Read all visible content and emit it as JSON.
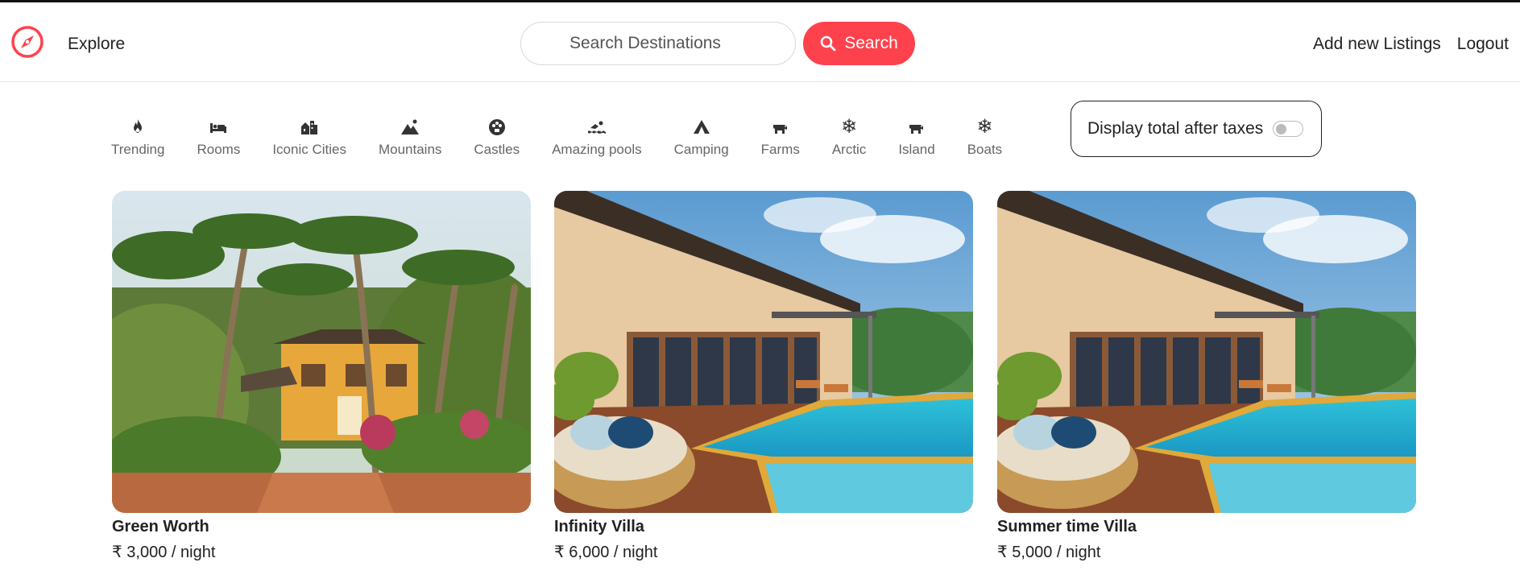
{
  "nav": {
    "explore_label": "Explore",
    "search_placeholder": "Search Destinations",
    "search_button_label": "Search",
    "add_listing_label": "Add new Listings",
    "logout_label": "Logout",
    "brand_color": "#fe424d"
  },
  "filters": [
    {
      "label": "Trending",
      "icon": "fire-icon"
    },
    {
      "label": "Rooms",
      "icon": "bed-icon"
    },
    {
      "label": "Iconic Cities",
      "icon": "city-icon"
    },
    {
      "label": "Mountains",
      "icon": "mountain-icon"
    },
    {
      "label": "Castles",
      "icon": "castle-icon"
    },
    {
      "label": "Amazing pools",
      "icon": "swimmer-icon"
    },
    {
      "label": "Camping",
      "icon": "tent-icon"
    },
    {
      "label": "Farms",
      "icon": "cow-icon"
    },
    {
      "label": "Arctic",
      "icon": "snowflake-icon"
    },
    {
      "label": "Island",
      "icon": "cow-icon"
    },
    {
      "label": "Boats",
      "icon": "snowflake-icon"
    }
  ],
  "tax_toggle": {
    "label": "Display total after taxes",
    "checked": false
  },
  "listings": [
    {
      "title": "Green Worth",
      "price": "₹ 3,000 / night",
      "image": "tropical-house-photo"
    },
    {
      "title": "Infinity Villa",
      "price": "₹ 6,000 / night",
      "image": "villa-pool-photo"
    },
    {
      "title": "Summer time Villa",
      "price": "₹ 5,000 / night",
      "image": "villa-pool-photo"
    }
  ]
}
